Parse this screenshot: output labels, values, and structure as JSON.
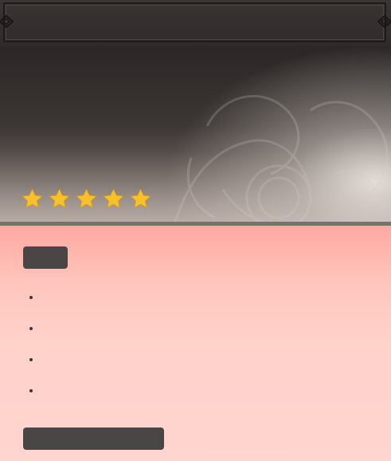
{
  "hero": {
    "rating": {
      "value": 5,
      "max": 5,
      "star_color": "#f7c12c"
    }
  },
  "content": {
    "bullets": [
      {
        "text": ""
      },
      {
        "text": ""
      },
      {
        "text": ""
      },
      {
        "text": ""
      }
    ]
  },
  "colors": {
    "banner": "#2f2b2a",
    "panel_top": "#fea9a0",
    "panel_bottom": "#ffd5cf",
    "pill": "#4a4645"
  }
}
